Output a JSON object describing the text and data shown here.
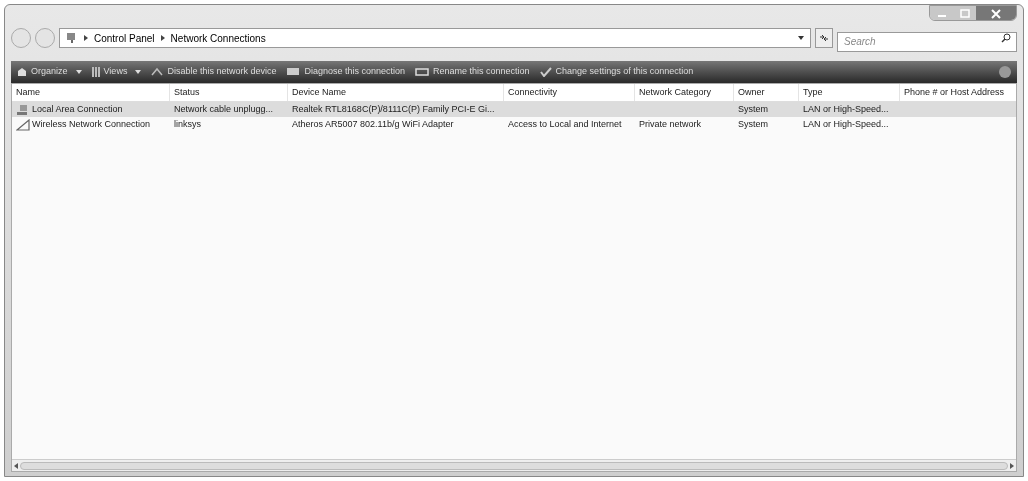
{
  "address_bar": {
    "breadcrumbs": [
      "Control Panel",
      "Network Connections"
    ],
    "search": {
      "placeholder": "Search"
    }
  },
  "toolbar": [
    {
      "label": "Organize",
      "kind": "menu"
    },
    {
      "label": "Views",
      "kind": "menu"
    },
    {
      "label": "Disable this network device",
      "kind": "disable"
    },
    {
      "label": "Diagnose this connection",
      "kind": "diagnose"
    },
    {
      "label": "Rename this connection",
      "kind": "rename"
    },
    {
      "label": "Change settings of this connection",
      "kind": "settings"
    }
  ],
  "table": {
    "columns": [
      "Name",
      "Status",
      "Device Name",
      "Connectivity",
      "Network Category",
      "Owner",
      "Type",
      "Phone # or Host Address"
    ],
    "rows": [
      {
        "kind": "wired",
        "selected": true,
        "cells": [
          "Local Area Connection",
          "Network cable unplugg...",
          "Realtek RTL8168C(P)/8111C(P) Family PCI-E Gi...",
          "",
          "",
          "System",
          "LAN or High-Speed...",
          ""
        ]
      },
      {
        "kind": "wireless",
        "selected": false,
        "cells": [
          "Wireless Network Connection",
          "linksys",
          "Atheros AR5007 802.11b/g WiFi Adapter",
          "Access to Local and Internet",
          "Private network",
          "System",
          "LAN or High-Speed...",
          ""
        ]
      }
    ]
  }
}
